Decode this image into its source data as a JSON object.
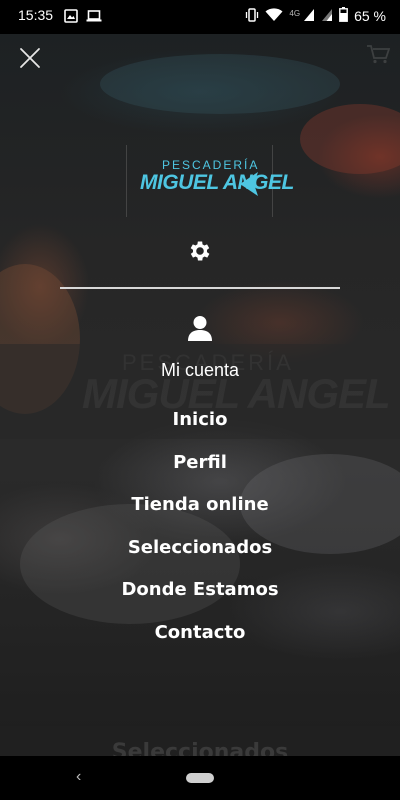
{
  "status_bar": {
    "time": "15:35",
    "network": "4G",
    "battery": "65 %",
    "left_icons": [
      "image-icon",
      "laptop-icon"
    ],
    "right_icons": [
      "vibrate-icon",
      "wifi-icon",
      "signal-icon",
      "signal-icon-2",
      "battery-icon"
    ]
  },
  "logo": {
    "top_text": "PESCADERÍA",
    "main_text": "MIGUEL ANGEL",
    "color": "#4ec6e2"
  },
  "account": {
    "label": "Mi cuenta"
  },
  "menu": {
    "items": [
      {
        "label": "Inicio"
      },
      {
        "label": "Perfil"
      },
      {
        "label": "Tienda online"
      },
      {
        "label": "Seleccionados"
      },
      {
        "label": "Donde Estamos"
      },
      {
        "label": "Contacto"
      }
    ]
  },
  "background": {
    "bottom_heading": "Seleccionados"
  },
  "nav_bar": {
    "back_glyph": "‹"
  }
}
